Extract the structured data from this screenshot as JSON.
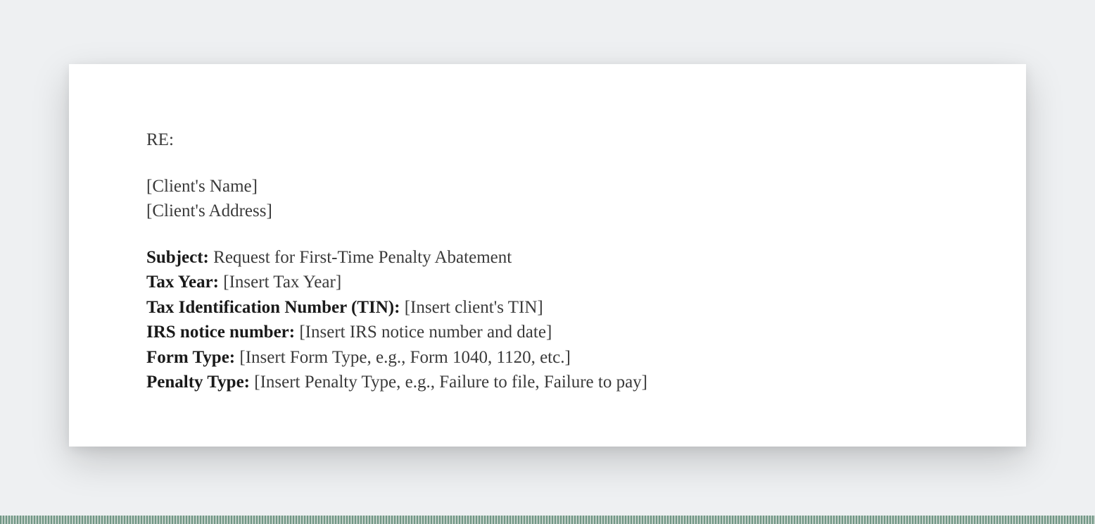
{
  "document": {
    "re_label": "RE:",
    "client_name": "[Client's Name]",
    "client_address": "[Client's Address]",
    "fields": {
      "subject": {
        "label": "Subject:",
        "value": " Request for First-Time Penalty Abatement"
      },
      "tax_year": {
        "label": "Tax Year:",
        "value": " [Insert Tax Year]"
      },
      "tin": {
        "label": "Tax Identification Number (TIN):",
        "value": " [Insert client's TIN]"
      },
      "irs_notice": {
        "label": "IRS notice number:",
        "value": " [Insert IRS notice number and date]"
      },
      "form_type": {
        "label": "Form Type:",
        "value": " [Insert Form Type, e.g., Form 1040, 1120, etc.]"
      },
      "penalty_type": {
        "label": "Penalty Type:",
        "value": " [Insert Penalty Type, e.g., Failure to file, Failure to pay]"
      }
    }
  }
}
